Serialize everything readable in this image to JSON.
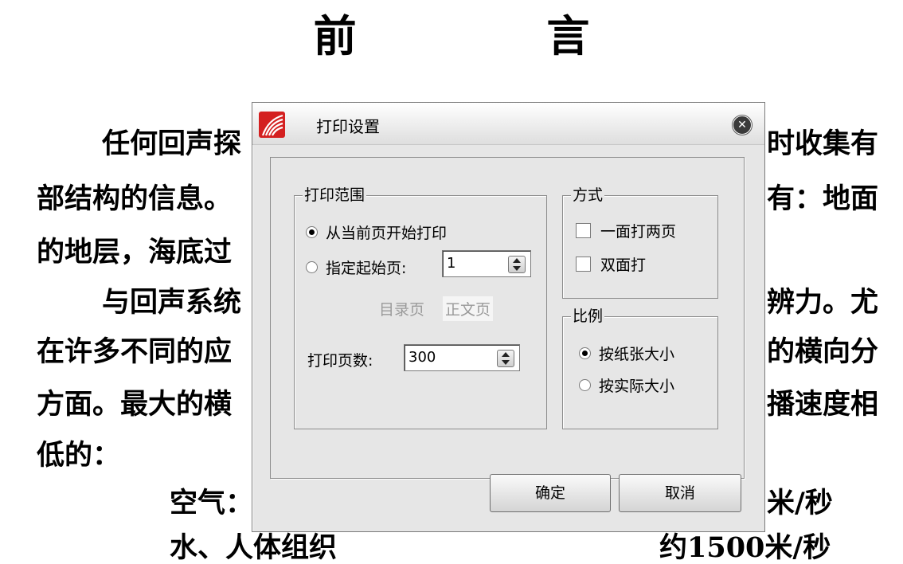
{
  "document": {
    "title": "前 言",
    "lines": [
      "任何回声探",
      "时收集有",
      "部结构的信息。",
      "有：地面",
      "的地层，海底过",
      "与回声系统",
      "辨力。尤",
      "在许多不同的应",
      "的横向分",
      "方面。最大的横",
      "播速度相",
      "低的：",
      "空气：",
      "米/秒",
      "水、人体组织",
      "约1500米/秒"
    ]
  },
  "dialog": {
    "title": "打印设置",
    "range": {
      "legend": "打印范围",
      "from_current_label": "从当前页开始打印",
      "from_current_selected": true,
      "specify_start_label": "指定起始页:",
      "specify_start_selected": false,
      "start_page_value": "1",
      "toc_page_label": "目录页",
      "body_page_label": "正文页",
      "page_count_label": "打印页数:",
      "page_count_value": "300"
    },
    "mode": {
      "legend": "方式",
      "two_per_side_label": "一面打两页",
      "two_per_side_checked": false,
      "duplex_label": "双面打",
      "duplex_checked": false
    },
    "scale": {
      "legend": "比例",
      "fit_paper_label": "按纸张大小",
      "fit_paper_selected": true,
      "actual_size_label": "按实际大小",
      "actual_size_selected": false
    },
    "ok_label": "确定",
    "cancel_label": "取消"
  }
}
